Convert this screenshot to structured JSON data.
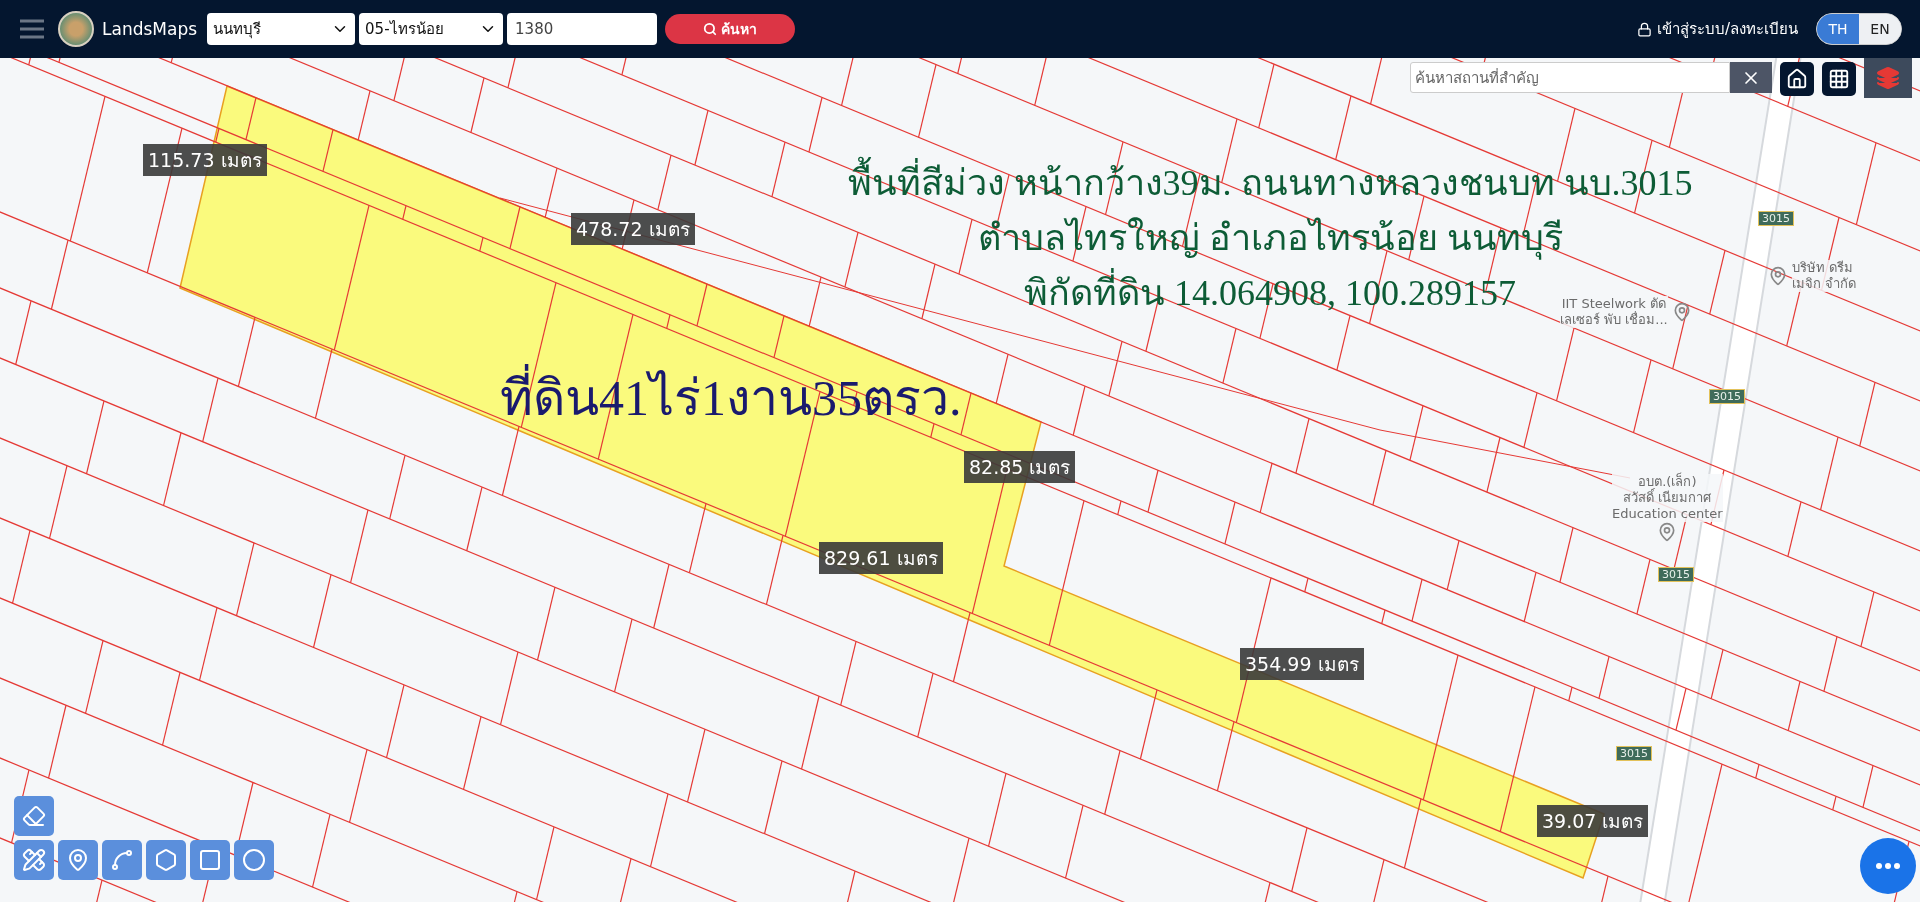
{
  "header": {
    "brand": "LandsMaps",
    "province": {
      "value": "นนทบุรี"
    },
    "district": {
      "value": "05-ไทรน้อย"
    },
    "parcel_field": {
      "value": "1380"
    },
    "search_button": "ค้นหา",
    "login_link": "เข้าสู่ระบบ/ลงทะเบียน",
    "languages": [
      {
        "label": "TH",
        "selected": true
      },
      {
        "label": "EN",
        "selected": false
      }
    ]
  },
  "map": {
    "place_search": {
      "placeholder": "ค้นหาสถานที่สำคัญ"
    },
    "distance_labels": [
      {
        "text": "115.73 เมตร"
      },
      {
        "text": "478.72 เมตร"
      },
      {
        "text": "82.85 เมตร"
      },
      {
        "text": "829.61 เมตร"
      },
      {
        "text": "354.99 เมตร"
      },
      {
        "text": "39.07 เมตร"
      }
    ],
    "area_label": "ที่ดิน41ไร่1งาน35ตรว.",
    "annotation": [
      "พื้นที่สีม่วง หน้ากว้าง39ม. ถนนทางหลวงชนบท นบ.3015",
      "ตำบลไทรใหญ่ อำเภอไทรน้อย นนทบุรี",
      "พิกัดที่ดิน 14.064908, 100.289157"
    ],
    "road_signs": [
      "3015",
      "3015",
      "3015",
      "3015"
    ],
    "places": [
      {
        "lines": [
          "IIT Steelwork ตัด",
          "เลเซอร์ พับ เชื่อม..."
        ]
      },
      {
        "lines": [
          "บริษัท ดรีม",
          "เมจิก จำกัด"
        ]
      },
      {
        "lines": [
          "อบต.(เล็ก)",
          "สวัสดิ์ เนียมกาศ",
          "Education center"
        ]
      }
    ]
  }
}
